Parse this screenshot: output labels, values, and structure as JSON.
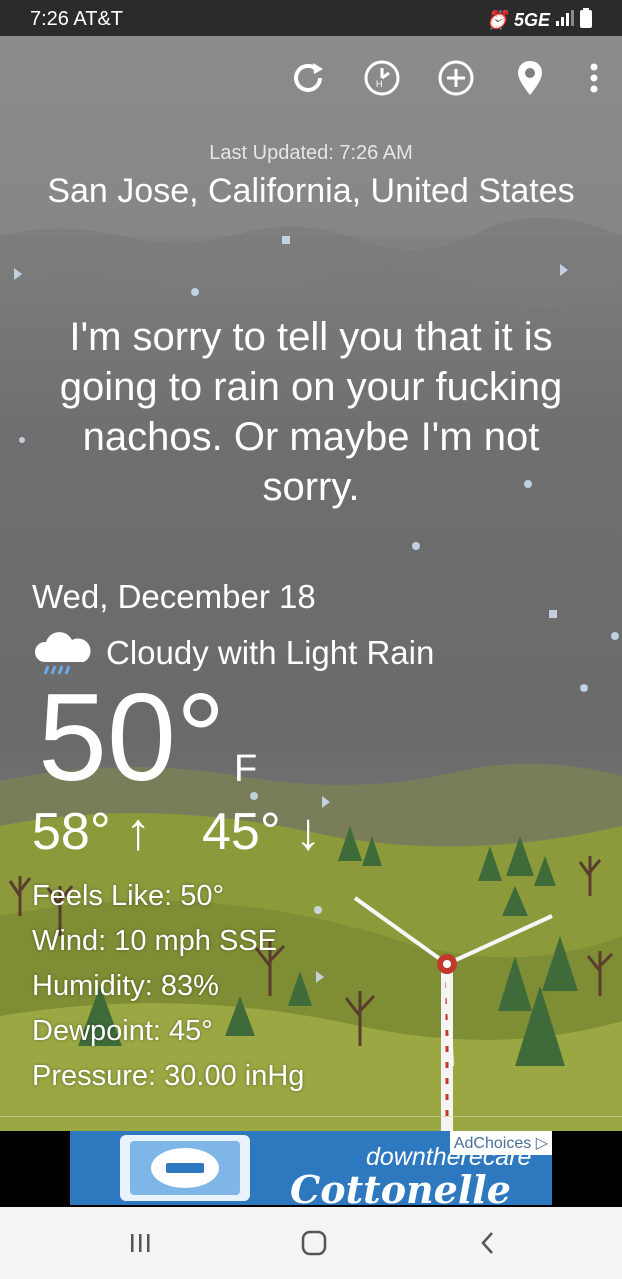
{
  "status_bar": {
    "time_carrier": "7:26 AT&T",
    "network": "5GE"
  },
  "toolbar": {
    "icons": [
      "refresh-icon",
      "hourly-icon",
      "add-icon",
      "location-pin-icon",
      "more-icon"
    ]
  },
  "header": {
    "last_updated": "Last Updated: 7:26 AM",
    "location": "San Jose, California, United States"
  },
  "message": "I'm sorry to tell you that it is going to rain on your fucking nachos. Or maybe I'm not sorry.",
  "forecast": {
    "date": "Wed, December 18",
    "condition": "Cloudy with Light Rain",
    "temperature": "50°",
    "unit": "F",
    "high": "58° ↑",
    "low": "45° ↓",
    "feels_like": "Feels Like: 50°",
    "wind": "Wind: 10 mph SSE",
    "humidity": "Humidity: 83%",
    "dewpoint": "Dewpoint: 45°",
    "pressure": "Pressure: 30.00 inHg"
  },
  "ad": {
    "tagline": "downtherecare",
    "brand": "Cottonelle",
    "choices": "AdChoices"
  },
  "colors": {
    "sky": "#7a7a7a",
    "hills": "#8f9a3a",
    "ad_blue": "#2e78c0"
  }
}
